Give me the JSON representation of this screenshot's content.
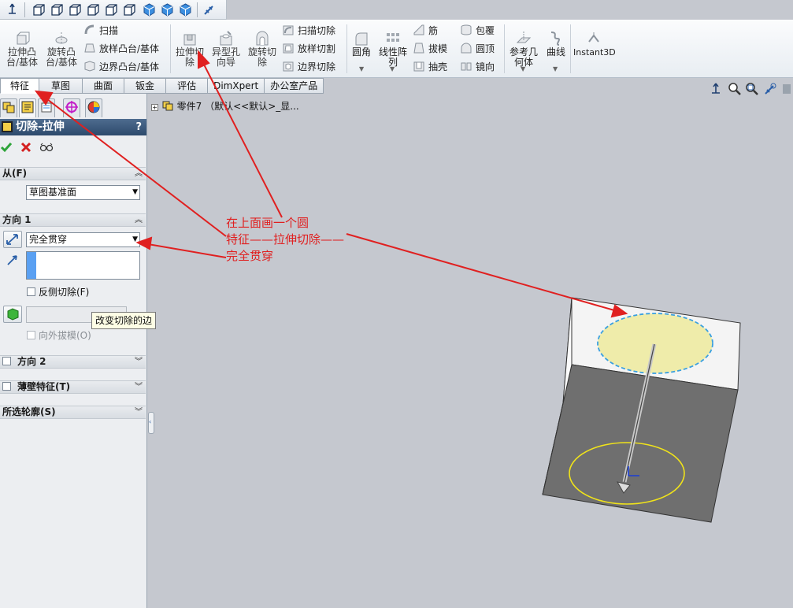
{
  "ribbon": {
    "extrude_boss": "拉伸凸\n台/基体",
    "revolve_boss": "旋转凸\n台/基体",
    "sweep": "扫描",
    "loft_boss": "放样凸台/基体",
    "boundary_boss": "边界凸台/基体",
    "extrude_cut": "拉伸切\n除",
    "hole_wizard": "异型孔\n向导",
    "revolve_cut": "旋转切\n除",
    "swept_cut": "扫描切除",
    "lofted_cut": "放样切割",
    "boundary_cut": "边界切除",
    "fillet": "圆角",
    "linear_pattern": "线性阵\n列",
    "rib": "筋",
    "draft": "拔模",
    "shell": "抽壳",
    "wrap": "包覆",
    "dome": "圆顶",
    "mirror": "镜向",
    "ref_geometry": "参考几\n何体",
    "curves": "曲线",
    "instant3d": "Instant3D"
  },
  "tabs": [
    "特征",
    "草图",
    "曲面",
    "钣金",
    "评估",
    "DimXpert",
    "办公室产品"
  ],
  "panel": {
    "title": "切除-拉伸",
    "help": "?",
    "from_section": "从(F)",
    "from_value": "草图基准面",
    "direction1_section": "方向 1",
    "direction1_value": "完全贯穿",
    "flip_side_label": "反侧切除(F)",
    "draft_outward_label": "向外拔模(O)",
    "tooltip": "改变切除的边",
    "direction2_section": "方向 2",
    "thin_feature_section": "薄壁特征(T)",
    "selected_contours_section": "所选轮廓(S)"
  },
  "tree": {
    "part_label": "零件7 （默认<<默认>_显..."
  },
  "annotation": {
    "line1": "在上面画一个圆",
    "line2": "特征——拉伸切除——",
    "line3": "完全贯穿"
  },
  "colors": {
    "annotation_red": "#e02020",
    "title_blue": "#3b5a7e",
    "circle_fill": "#efecaa"
  }
}
